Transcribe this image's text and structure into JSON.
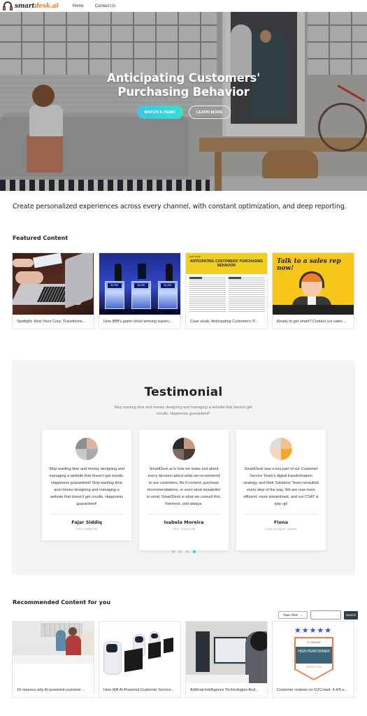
{
  "nav": {
    "logo_main": "smart",
    "logo_accent": "desk.ai",
    "links": [
      "Home",
      "Contact Us"
    ]
  },
  "hero": {
    "title": "Anticipating Customers' Purchasing Behavior",
    "primary_button": "WATCH A DEMO",
    "secondary_button": "LEARN MORE"
  },
  "tagline": "Create personalized experiences across every channel, with constant optimization, and deep reporting.",
  "featured": {
    "heading": "Featured Content",
    "items": [
      {
        "title": "Spotlight: How Vivor Corp. Transforme...",
        "image": "laptop-typing"
      },
      {
        "title": "How IBM's game show winning superc...",
        "image": "jeopardy-stage"
      },
      {
        "title": "Case study: Anticipating Customers' P...",
        "image": "case-study-document",
        "image_tag": "case study",
        "image_heading": "ANTICIPATING CUSTOMERS' PURCHASING BEHAVIOR"
      },
      {
        "title": "Ready to get smart? Contact our sales ...",
        "image": "sales-rep-illustration",
        "image_text": "Talk to a sales rep now!"
      }
    ]
  },
  "testimonial": {
    "heading": "Testimonial",
    "subheading": "Stop wasting time and money designing and managing a website that doesn't get results. Happiness guaranteed!",
    "items": [
      {
        "quote": "Stop wasting time and money designing and managing a website that doesn't get results. Happiness guaranteed! Stop wasting time and money designing and managing a website that doesn't get results. Happiness guaranteed!",
        "name": "Fajar Siddiq",
        "role": "CEO, MakerFlix"
      },
      {
        "quote": "SmartDesk.ai is how we make just about every decision about what we recommend to our customers. Be it content, purchase recommendations, or even what newsletter to send, SmartDesk is what we consult first, foremost, and always.",
        "name": "Isabela Moreira",
        "role": "CEO, GrayGrids"
      },
      {
        "quote": "SmartDesk was a key part of our Customer Service Team's digital transformation strategy, and their Solutions Team consulted every step of the way. We are now more efficient, more streamlined, and our CSAT is way up!",
        "name": "Fiona",
        "role": "Lead Designer, UIdeck"
      }
    ],
    "pagination": {
      "total": 4,
      "active": 4
    }
  },
  "recommended": {
    "heading": "Recommended Content for you",
    "filter": {
      "selected": "Topic Filter",
      "search_value": "",
      "search_button": "Search"
    },
    "items": [
      {
        "title": "10 reasons why AI-powered customer ...",
        "image": "support-team-headsets"
      },
      {
        "title": "How Will AI-Powered Customer Service...",
        "image": "robots-at-computers"
      },
      {
        "title": "Artificial Intelligence Technologies And...",
        "image": "woman-at-monitors"
      },
      {
        "title": "Customer reviews on G2Crowd: 4.4/5 s...",
        "image": "g2-crowd-badge",
        "badge_top": "G CROWD",
        "badge_main": "HIGH PERFORMER",
        "badge_bottom": "WINTER 2019",
        "stars": "★★★★★"
      }
    ]
  },
  "colors": {
    "accent_gradient_start": "#3bc4e6",
    "accent_gradient_end": "#36e0cc",
    "logo_accent": "#f07a2a",
    "search_button": "#2e3e4c",
    "testimonial_bg": "#f2f4f5",
    "dot_active": "#2fd3b5"
  }
}
